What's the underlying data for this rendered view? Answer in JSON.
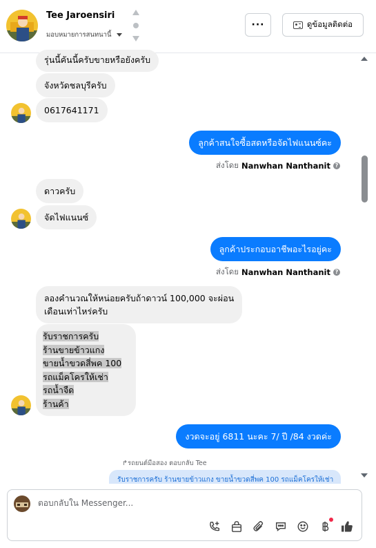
{
  "header": {
    "contact_name": "Tee Jaroensiri",
    "assign_label": "มอบหมายการสนทนานี้",
    "more_label": "···",
    "contact_info_label": "ดูข้อมูลติดต่อ"
  },
  "messages": {
    "m1": "รุ่นนี้คันนี้ครับขายหรือยังครับ",
    "m2": "จังหวัดชลบุรีครับ",
    "m3": "0617641171",
    "m4": "ลูกค้าสนใจซื้อสดหรือจัดไฟแนนซ์คะ",
    "m4_sent_prefix": "ส่งโดย",
    "m4_sent_name": "Nanwhan Nanthanit",
    "m5": "ดาวครับ",
    "m6": "จัดไฟแนนซ์",
    "m7": "ลูกค้าประกอบอาชีพอะไรอยู่คะ",
    "m7_sent_prefix": "ส่งโดย",
    "m7_sent_name": "Nanwhan Nanthanit",
    "m8_line1": "ลองคำนวณให้หน่อยครับถ้าดาวน์ 100,000 จะผ่อน",
    "m8_line2": "เดือนเท่าไหร่ครับ",
    "m9_lines": [
      "รับราชการครับ",
      "ร้านขายข้าวแกง",
      "ขายน้ำขวดสี่พค 100",
      "รถแม็คโครให้เช่า",
      "รถน้ำจืด",
      "ร้านค้า"
    ],
    "m10": "งวดจะอยู่  6811 นะคะ  7/ ปี /84 งวดค่ะ",
    "reply_note": "↱รถยนต์มือสอง ตอบกลับ Tee",
    "reply_preview": "รับราชการครับ ร้านขายข้าวแกง ขายน้ำขวดสี่พค 100 รถแม็คโครให้เช่า"
  },
  "composer": {
    "placeholder": "ตอบกลับใน Messenger..."
  },
  "colors": {
    "outgoing_bubble": "#0a7cff",
    "incoming_bubble": "#f0f0f0",
    "highlight": "#c8c8c8"
  },
  "icons": [
    "add-call-icon",
    "bag-icon",
    "paperclip-icon",
    "saved-reply-icon",
    "emoji-icon",
    "baht-icon",
    "thumbs-up-icon"
  ]
}
